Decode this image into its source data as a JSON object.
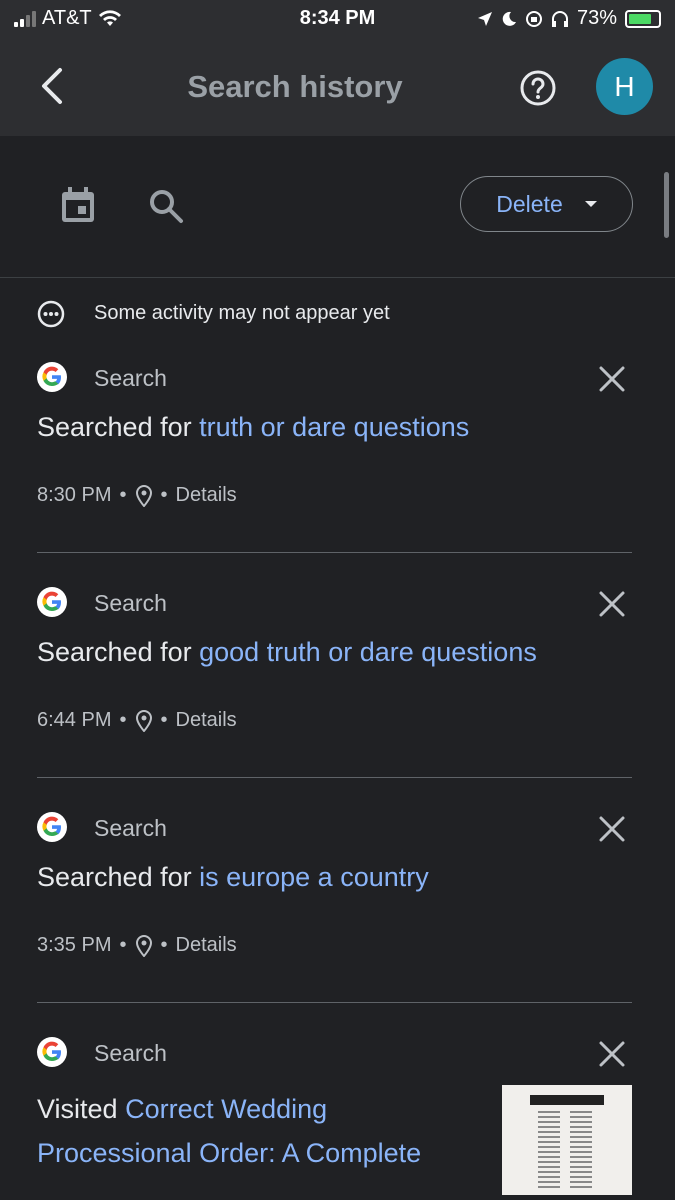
{
  "status_bar": {
    "carrier": "AT&T",
    "time": "8:34 PM",
    "battery_percent": "73%"
  },
  "header": {
    "title": "Search history",
    "avatar_letter": "H"
  },
  "toolbar": {
    "delete_label": "Delete"
  },
  "notice": "Some activity may not appear yet",
  "entries": [
    {
      "source": "Search",
      "prefix": "Searched for",
      "query": "truth or dare questions",
      "time": "8:30 PM",
      "details": "Details"
    },
    {
      "source": "Search",
      "prefix": "Searched for",
      "query": "good truth or dare questions",
      "time": "6:44 PM",
      "details": "Details"
    },
    {
      "source": "Search",
      "prefix": "Searched for",
      "query": "is europe a country",
      "time": "3:35 PM",
      "details": "Details"
    },
    {
      "source": "Search",
      "prefix": "Visited",
      "query": "Correct Wedding Processional Order: A Complete"
    }
  ],
  "colors": {
    "background": "#202124",
    "appbar": "#2d2e31",
    "link": "#8ab4f8",
    "avatar": "#1f8aa8"
  },
  "icons": [
    "back-arrow-icon",
    "help-icon",
    "calendar-icon",
    "search-icon",
    "more-horiz-icon",
    "google-icon",
    "close-icon",
    "location-pin-icon"
  ]
}
